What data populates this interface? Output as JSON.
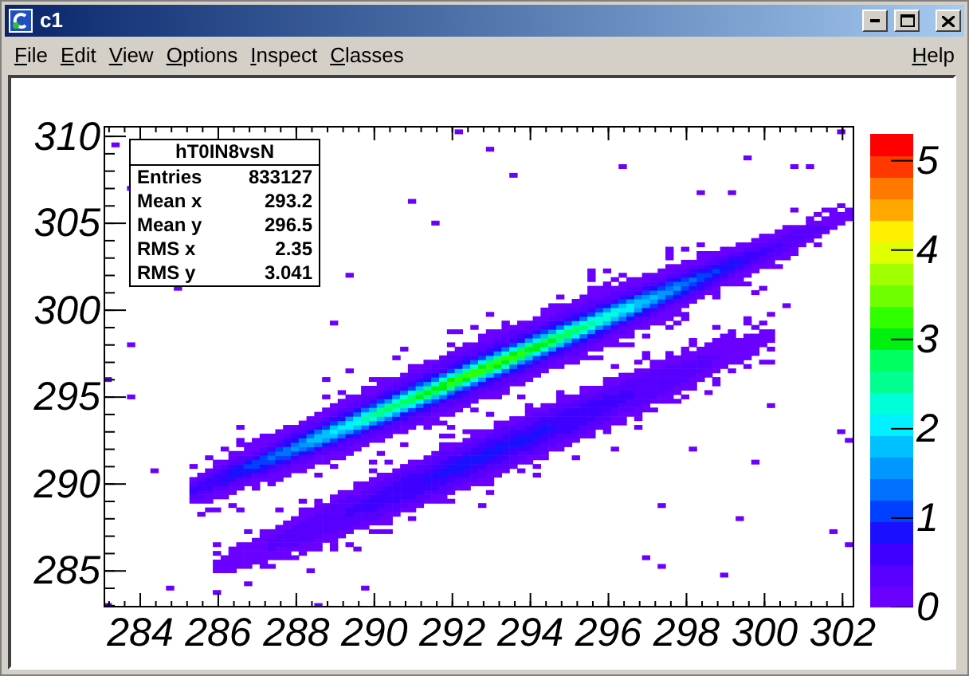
{
  "window": {
    "title": "c1"
  },
  "menu": [
    {
      "label": "File"
    },
    {
      "label": "Edit"
    },
    {
      "label": "View"
    },
    {
      "label": "Options"
    },
    {
      "label": "Inspect"
    },
    {
      "label": "Classes"
    }
  ],
  "help_menu": {
    "label": "Help"
  },
  "stats": {
    "title": "hT0IN8vsN",
    "rows": [
      {
        "name": "Entries",
        "value": "833127"
      },
      {
        "name": "Mean x",
        "value": "293.2"
      },
      {
        "name": "Mean y",
        "value": "296.5"
      },
      {
        "name": "RMS x",
        "value": "2.35"
      },
      {
        "name": "RMS y",
        "value": "3.041"
      }
    ]
  },
  "x_axis": {
    "ticks": [
      "284",
      "286",
      "288",
      "290",
      "292",
      "294",
      "296",
      "298",
      "300",
      "302"
    ]
  },
  "y_axis": {
    "ticks": [
      "310",
      "305",
      "300",
      "295",
      "290",
      "285"
    ]
  },
  "palette": {
    "ticks": [
      "5",
      "4",
      "3",
      "2",
      "1",
      "0"
    ]
  }
}
